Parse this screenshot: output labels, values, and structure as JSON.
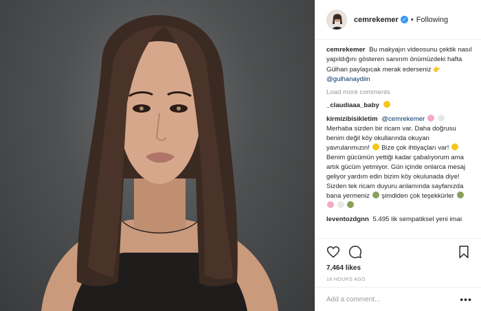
{
  "post": {
    "image_alt": "Portrait photo of a woman with long brown hair against a dark grey backdrop"
  },
  "header": {
    "username": "cemrekemer",
    "separator": "•",
    "follow_status": "Following",
    "verified_mark": "✓"
  },
  "caption": {
    "username": "cemrekemer",
    "text": "Bu makyajın videosunu çektik nasıl yapıldığını gösteren sanırım önümüzdeki hafta Gülhan paylaşıcak merak ederseniz",
    "mention": "@gulhanaydiin"
  },
  "load_more": "Load more comments",
  "comments": [
    {
      "username": "_claudiaaa_baby",
      "text": ""
    },
    {
      "username": "kirmizibisikletim",
      "mention": "@cemrekemer",
      "text_1": "Merhaba sizden bir ricam var. Daha doğrusu benim değil köy okullarında okuyan yavrularımızın!",
      "text_2": "Bize çok ihtiyaçları var!",
      "text_3": "Benim gücümün yettiği kadar çabalıyorum ama artık gücüm yetmiyor. Gün içinde onlarca mesaj geliyor yardım edin bizim köy okulunada diye! Sizden tek ricam duyuru anlamında sayfanızda bana yermeniz",
      "text_4": "şimdiden çok teşekkürler"
    },
    {
      "username": "leventozdgnn",
      "text": "5.495 lik sempatiksel yeni imai"
    }
  ],
  "actions": {
    "likes": "7,464 likes",
    "time": "18 HOURS AGO"
  },
  "add_comment": {
    "placeholder": "Add a comment...",
    "more": "•••"
  },
  "colors": {
    "link": "#003569",
    "verified": "#3897f0",
    "muted": "#999999"
  },
  "icons": [
    "heart-icon",
    "comment-icon",
    "bookmark-icon",
    "more-icon",
    "verified-icon"
  ]
}
